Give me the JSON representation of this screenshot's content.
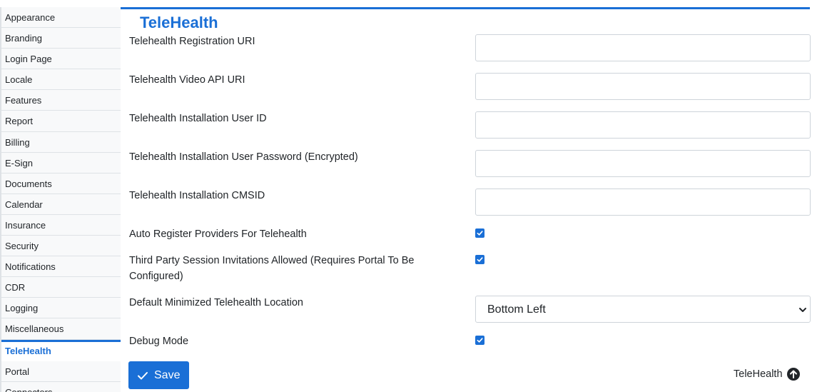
{
  "sidebar": {
    "items": [
      {
        "label": "Appearance"
      },
      {
        "label": "Branding"
      },
      {
        "label": "Login Page"
      },
      {
        "label": "Locale"
      },
      {
        "label": "Features"
      },
      {
        "label": "Report"
      },
      {
        "label": "Billing"
      },
      {
        "label": "E-Sign"
      },
      {
        "label": "Documents"
      },
      {
        "label": "Calendar"
      },
      {
        "label": "Insurance"
      },
      {
        "label": "Security"
      },
      {
        "label": "Notifications"
      },
      {
        "label": "CDR"
      },
      {
        "label": "Logging"
      },
      {
        "label": "Miscellaneous"
      },
      {
        "label": "TeleHealth",
        "active": true
      },
      {
        "label": "Portal"
      },
      {
        "label": "Connectors"
      }
    ]
  },
  "main": {
    "title": "TeleHealth",
    "fields": [
      {
        "label": "Telehealth Registration URI",
        "value": ""
      },
      {
        "label": "Telehealth Video API URI",
        "value": ""
      },
      {
        "label": "Telehealth Installation User ID",
        "value": ""
      },
      {
        "label": "Telehealth Installation User Password (Encrypted)",
        "value": ""
      },
      {
        "label": "Telehealth Installation CMSID",
        "value": ""
      }
    ],
    "auto_register": {
      "label": "Auto Register Providers For Telehealth",
      "checked": true
    },
    "third_party": {
      "label_line1": "Third Party Session Invitations Allowed (Requires Portal To Be",
      "label_line2": "Configured)",
      "checked": true
    },
    "minimized_location": {
      "label": "Default Minimized Telehealth Location",
      "selected": "Bottom Left"
    },
    "debug_mode": {
      "label": "Debug Mode",
      "checked": true
    },
    "save_label": "Save",
    "footer_link": "TeleHealth"
  },
  "colors": {
    "accent": "#1a6fd6",
    "border": "#ced4da",
    "sidebar_bg": "#f8f9fa"
  },
  "icons": {
    "save": "check-icon",
    "footer": "arrow-up-circle-icon",
    "select": "chevron-down-icon"
  }
}
